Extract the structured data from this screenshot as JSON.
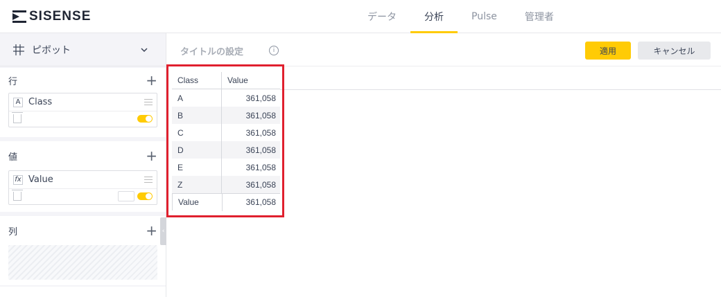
{
  "brand": {
    "name": "SISENSE"
  },
  "nav": {
    "tabs": [
      {
        "label": "データ",
        "active": false
      },
      {
        "label": "分析",
        "active": true
      },
      {
        "label": "Pulse",
        "active": false
      },
      {
        "label": "管理者",
        "active": false
      }
    ]
  },
  "left_panel": {
    "widget_type": {
      "label": "ピボット",
      "icon": "grid-icon"
    },
    "rows_section": {
      "title": "行",
      "items": [
        {
          "type_badge": "A",
          "name": "Class"
        }
      ]
    },
    "values_section": {
      "title": "値",
      "items": [
        {
          "type_badge": "fx",
          "name": "Value"
        }
      ]
    },
    "columns_section": {
      "title": "列"
    }
  },
  "toolbar": {
    "title_placeholder": "タイトルの設定",
    "apply_label": "適用",
    "cancel_label": "キャンセル"
  },
  "pivot": {
    "columns": [
      "Class",
      "Value"
    ],
    "rows": [
      [
        "A",
        "361,058"
      ],
      [
        "B",
        "361,058"
      ],
      [
        "C",
        "361,058"
      ],
      [
        "D",
        "361,058"
      ],
      [
        "E",
        "361,058"
      ],
      [
        "Z",
        "361,058"
      ]
    ],
    "total": [
      "Value",
      "361,058"
    ]
  },
  "colors": {
    "accent": "#ffcb05",
    "highlight": "#e0202e"
  }
}
